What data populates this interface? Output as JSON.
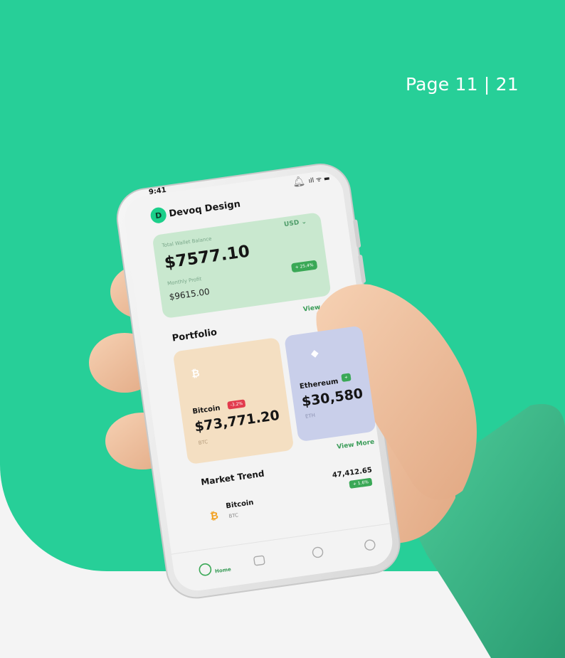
{
  "page": {
    "label": "Page 11 | 21"
  },
  "phone": {
    "status_time": "9:41",
    "brand_name": "Devoq Design",
    "balance": {
      "label": "Total Wallet Balance",
      "currency": "USD ⌄",
      "value": "$7577.10",
      "profit_label": "Monthly Profit",
      "profit_value": "$9615.00",
      "profit_change": "+ 25.4%"
    },
    "portfolio": {
      "title": "Portfolio",
      "view_link": "View",
      "assets": [
        {
          "name": "Bitcoin",
          "change": "-3.2%",
          "value": "$73,771.20",
          "ticker": "BTC"
        },
        {
          "name": "Ethereum",
          "change": "+",
          "value": "$30,580",
          "ticker": "ETH"
        }
      ]
    },
    "market": {
      "title": "Market Trend",
      "view_more": "View More",
      "items": [
        {
          "name": "Bitcoin",
          "ticker": "BTC",
          "value": "47,412.65",
          "change": "+ 1.6%"
        }
      ]
    },
    "nav": {
      "home_label": "Home"
    }
  },
  "colors": {
    "background_green": "#27cf98",
    "card_green": "#c9e8cf",
    "card_orange": "#f4dfc2",
    "card_purple": "#c9cfea",
    "accent_green": "#3aa856",
    "accent_red": "#e23b4d"
  }
}
